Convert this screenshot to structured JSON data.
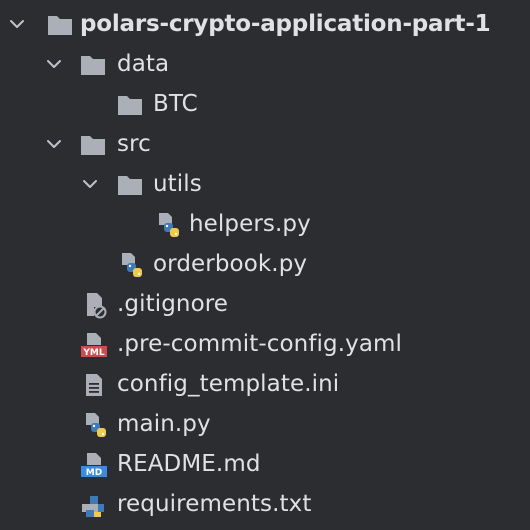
{
  "project_tree": {
    "root": {
      "label": "polars-crypto-application-part-1",
      "icon": "folder-icon",
      "expanded": true
    },
    "items": [
      {
        "label": "data",
        "icon": "folder-icon",
        "expanded": true
      },
      {
        "label": "BTC",
        "icon": "folder-icon"
      },
      {
        "label": "src",
        "icon": "folder-icon",
        "expanded": true
      },
      {
        "label": "utils",
        "icon": "folder-icon",
        "expanded": true
      },
      {
        "label": "helpers.py",
        "icon": "python-file-icon"
      },
      {
        "label": "orderbook.py",
        "icon": "python-file-icon"
      },
      {
        "label": ".gitignore",
        "icon": "ignored-file-icon"
      },
      {
        "label": ".pre-commit-config.yaml",
        "icon": "yaml-file-icon",
        "badge": "YML"
      },
      {
        "label": "config_template.ini",
        "icon": "text-file-icon"
      },
      {
        "label": "main.py",
        "icon": "python-file-icon"
      },
      {
        "label": "README.md",
        "icon": "markdown-file-icon",
        "badge": "MD"
      },
      {
        "label": "requirements.txt",
        "icon": "requirements-file-icon"
      }
    ]
  },
  "colors": {
    "background": "#2b2d30",
    "text": "#dfe1e5",
    "folder": "#abb0b8",
    "python_blue": "#3d7ab8",
    "python_yellow": "#f2c94c",
    "yaml_red": "#c94f4f",
    "markdown_blue": "#3d8bd9"
  }
}
